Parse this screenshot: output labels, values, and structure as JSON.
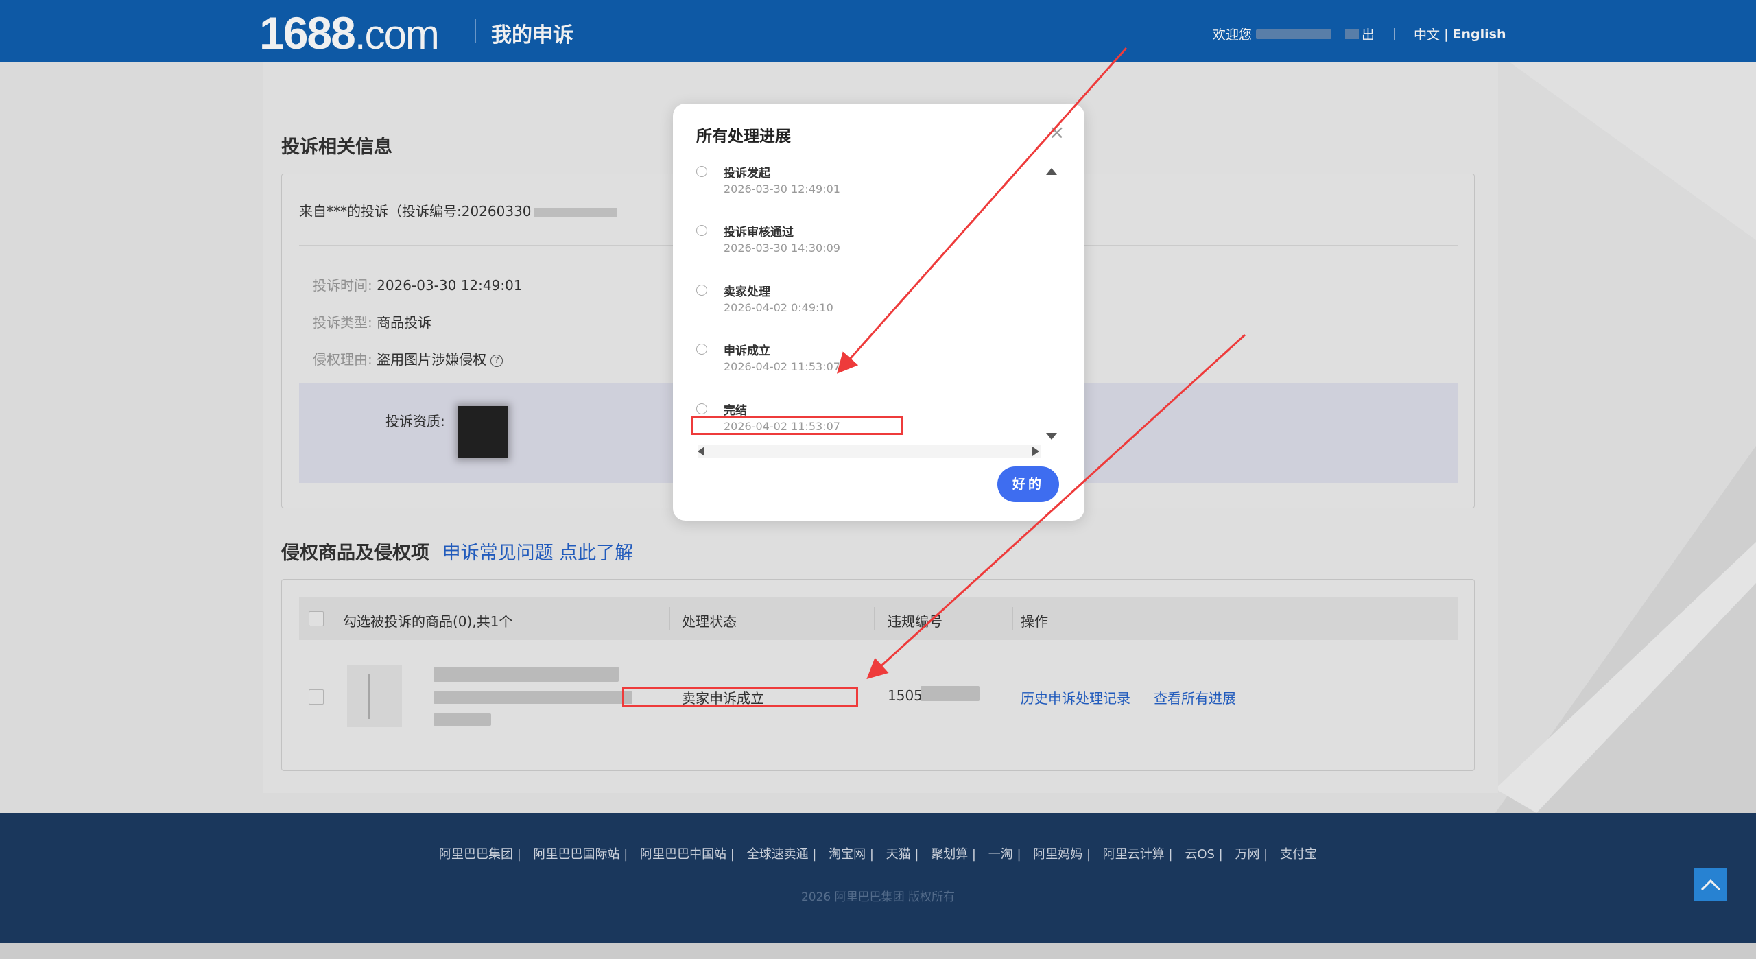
{
  "header": {
    "logo_main": "1688",
    "logo_suffix": ".com",
    "page_title": "我的申诉",
    "welcome": "欢迎您",
    "logout_suffix": "出",
    "lang_zh": "中文",
    "lang_sep": " | ",
    "lang_en": "English"
  },
  "complaint_info": {
    "section_title": "投诉相关信息",
    "header_text": "来自***的投诉（投诉编号:20260330",
    "rows": [
      {
        "label": "投诉时间:",
        "value": "2026-03-30 12:49:01"
      },
      {
        "label": "投诉类型:",
        "value": "商品投诉"
      },
      {
        "label": "侵权理由:",
        "value": "盗用图片涉嫌侵权"
      }
    ],
    "qualification_label": "投诉资质:"
  },
  "products": {
    "section_title": "侵权商品及侵权项",
    "faq_link": "申诉常见问题 点此了解",
    "columns": {
      "select": "勾选被投诉的商品(0),共1个",
      "status": "处理状态",
      "violation_no": "违规编号",
      "actions": "操作"
    },
    "row": {
      "status": "卖家申诉成立",
      "violation_no_prefix": "1505",
      "history_link": "历史申诉处理记录",
      "progress_link": "查看所有进展"
    }
  },
  "modal": {
    "title": "所有处理进展",
    "close_icon": "×",
    "steps": [
      {
        "label": "投诉发起",
        "time": "2026-03-30 12:49:01"
      },
      {
        "label": "投诉审核通过",
        "time": "2026-03-30 14:30:09"
      },
      {
        "label": "卖家处理",
        "time": "2026-04-02 0:49:10"
      },
      {
        "label": "申诉成立",
        "time": "2026-04-02 11:53:07"
      },
      {
        "label": "完结",
        "time": "2026-04-02 11:53:07"
      }
    ],
    "ok_button": "好的"
  },
  "footer": {
    "links": [
      "阿里巴巴集团 |",
      "阿里巴巴国际站 |",
      "阿里巴巴中国站 |",
      "全球速卖通 |",
      "淘宝网 |",
      "天猫 |",
      "聚划算 |",
      "一淘 |",
      "阿里妈妈 |",
      "阿里云计算 |",
      "云OS |",
      "万网 |",
      "支付宝"
    ],
    "copyright": "2026 阿里巴巴集团 版权所有"
  },
  "colors": {
    "header_bg": "#0f5fb0",
    "footer_bg": "#1c3b62",
    "link": "#2461c8",
    "button": "#3e6df0",
    "annotation_red": "#ee3b3b"
  }
}
